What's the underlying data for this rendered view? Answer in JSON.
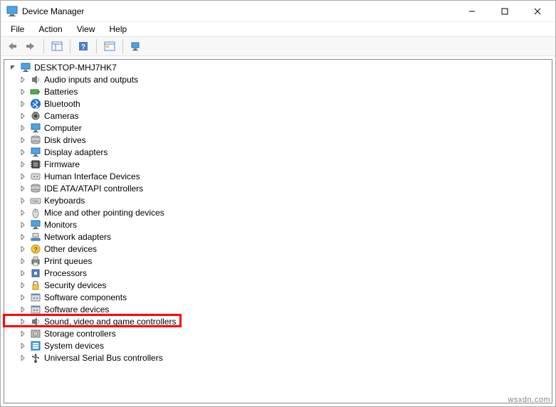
{
  "window": {
    "title": "Device Manager"
  },
  "menubar": {
    "file": "File",
    "action": "Action",
    "view": "View",
    "help": "Help"
  },
  "tree": {
    "root": "DESKTOP-MHJ7HK7",
    "items": [
      {
        "label": "Audio inputs and outputs",
        "icon": "speaker"
      },
      {
        "label": "Batteries",
        "icon": "battery"
      },
      {
        "label": "Bluetooth",
        "icon": "bluetooth"
      },
      {
        "label": "Cameras",
        "icon": "camera"
      },
      {
        "label": "Computer",
        "icon": "monitor"
      },
      {
        "label": "Disk drives",
        "icon": "disk"
      },
      {
        "label": "Display adapters",
        "icon": "monitor"
      },
      {
        "label": "Firmware",
        "icon": "chip"
      },
      {
        "label": "Human Interface Devices",
        "icon": "hid"
      },
      {
        "label": "IDE ATA/ATAPI controllers",
        "icon": "disk"
      },
      {
        "label": "Keyboards",
        "icon": "keyboard"
      },
      {
        "label": "Mice and other pointing devices",
        "icon": "mouse"
      },
      {
        "label": "Monitors",
        "icon": "monitor"
      },
      {
        "label": "Network adapters",
        "icon": "network"
      },
      {
        "label": "Other devices",
        "icon": "other"
      },
      {
        "label": "Print queues",
        "icon": "printer"
      },
      {
        "label": "Processors",
        "icon": "cpu"
      },
      {
        "label": "Security devices",
        "icon": "security"
      },
      {
        "label": "Software components",
        "icon": "software"
      },
      {
        "label": "Software devices",
        "icon": "software"
      },
      {
        "label": "Sound, video and game controllers",
        "icon": "speaker",
        "highlight": true
      },
      {
        "label": "Storage controllers",
        "icon": "storage"
      },
      {
        "label": "System devices",
        "icon": "system"
      },
      {
        "label": "Universal Serial Bus controllers",
        "icon": "usb"
      }
    ]
  },
  "watermark": "wsxdn.com"
}
